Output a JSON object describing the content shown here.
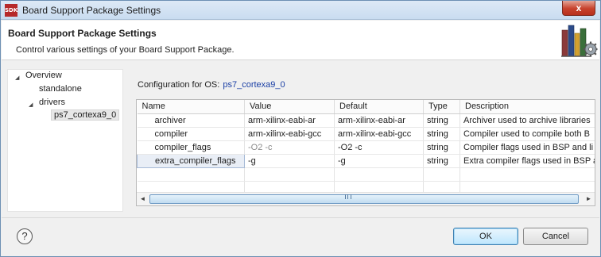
{
  "window": {
    "title": "Board Support Package Settings",
    "app_icon_text": "SDK",
    "close_glyph": "x"
  },
  "header": {
    "title": "Board Support Package Settings",
    "description": "Control various settings of your Board Support Package.",
    "icon": "books-gear-icon"
  },
  "tree": {
    "items": [
      {
        "label": "Overview",
        "expanded": true
      },
      {
        "label": "standalone"
      },
      {
        "label": "drivers",
        "expanded": true
      },
      {
        "label": "ps7_cortexa9_0",
        "selected": true
      }
    ]
  },
  "config": {
    "label": "Configuration for OS:",
    "os": "ps7_cortexa9_0"
  },
  "table": {
    "columns": [
      "Name",
      "Value",
      "Default",
      "Type",
      "Description"
    ],
    "rows": [
      {
        "name": "archiver",
        "value": "arm-xilinx-eabi-ar",
        "default": "arm-xilinx-eabi-ar",
        "type": "string",
        "description": "Archiver used to archive libraries"
      },
      {
        "name": "compiler",
        "value": "arm-xilinx-eabi-gcc",
        "default": "arm-xilinx-eabi-gcc",
        "type": "string",
        "description": "Compiler used to compile both B"
      },
      {
        "name": "compiler_flags",
        "value": "-O2 -c",
        "default": "-O2 -c",
        "type": "string",
        "description": "Compiler flags used in BSP and li"
      },
      {
        "name": "extra_compiler_flags",
        "value": "-g",
        "default": "-g",
        "type": "string",
        "description": "Extra compiler flags used in BSP a"
      }
    ]
  },
  "scrollbar": {
    "left_arrow": "◄",
    "right_arrow": "►",
    "grip": "III"
  },
  "buttons": {
    "help": "?",
    "ok": "OK",
    "cancel": "Cancel"
  },
  "colors": {
    "accent_link": "#1a3fa5",
    "title_bar": "#c9dcf0",
    "close_button": "#c7412c"
  }
}
